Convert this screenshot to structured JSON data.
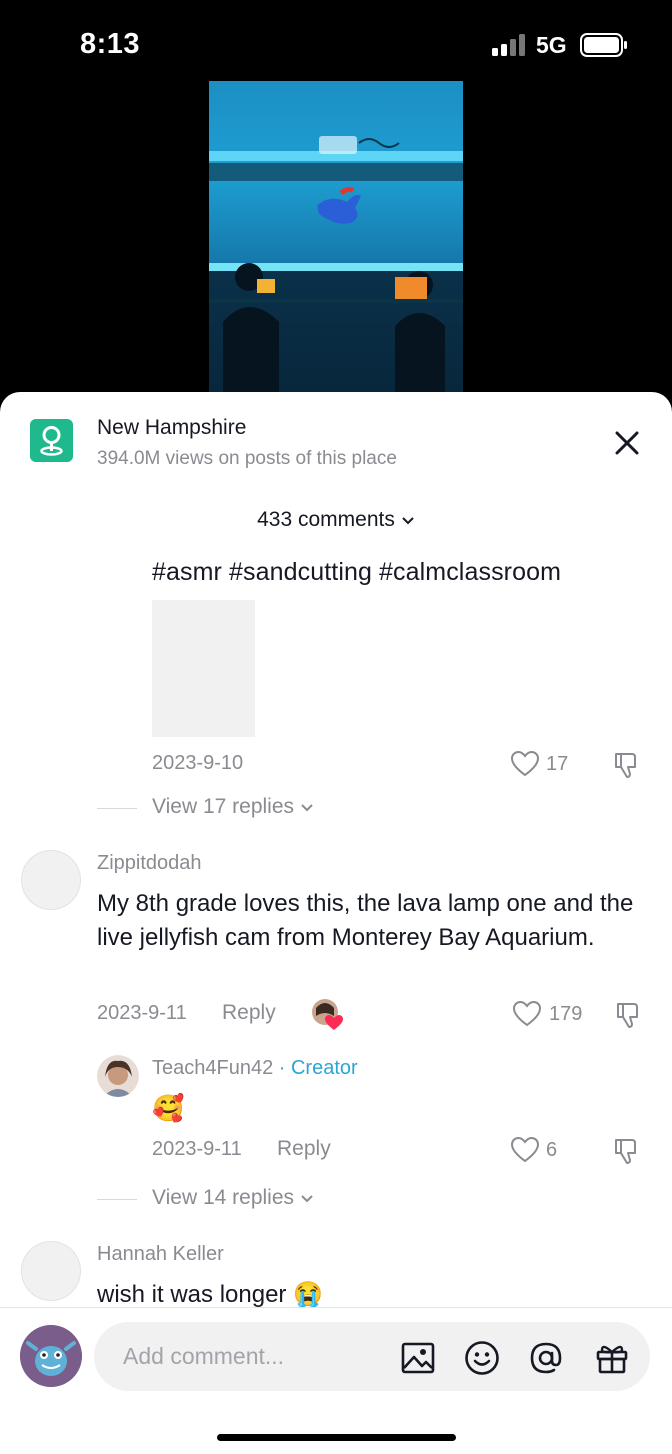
{
  "status": {
    "time": "8:13",
    "network": "5G"
  },
  "place": {
    "name": "New Hampshire",
    "views": "394.0M views on posts of this place",
    "icon": "map-pin-icon",
    "color": "#20b98d"
  },
  "comments_header": {
    "count_label": "433 comments"
  },
  "comments": [
    {
      "text": "#asmr #sandcutting #calmclassroom",
      "date": "2023-9-10",
      "likes": "17",
      "view_replies": "View 17 replies"
    },
    {
      "username": "Zippitdodah",
      "text": "My 8th grade loves this, the lava lamp one and the live jellyfish cam from Monterey Bay Aquarium.",
      "date": "2023-9-11",
      "reply_label": "Reply",
      "likes": "179"
    },
    {
      "username": "Teach4Fun42",
      "creator_label": "· Creator",
      "text": "🥰",
      "date": "2023-9-11",
      "reply_label": "Reply",
      "likes": "6",
      "view_replies": "View 14 replies"
    },
    {
      "username": "Hannah Keller",
      "text": "wish it was longer 😭"
    }
  ],
  "composer": {
    "placeholder": "Add comment...",
    "icons": [
      "image-icon",
      "emoji-icon",
      "mention-icon",
      "gift-icon"
    ]
  },
  "colors": {
    "accent_creator": "#2aa6d4",
    "muted_text": "#8a8b91"
  }
}
